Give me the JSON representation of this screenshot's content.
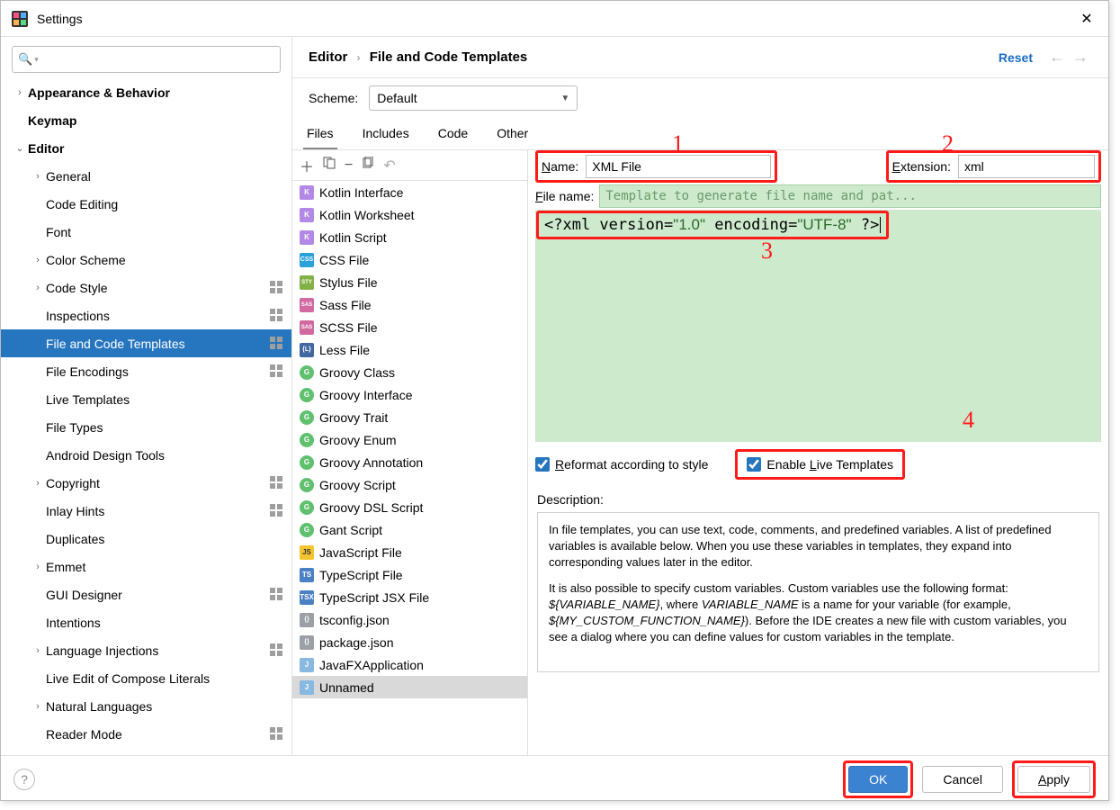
{
  "window": {
    "title": "Settings"
  },
  "crumbs": {
    "section": "Editor",
    "page": "File and Code Templates",
    "reset": "Reset"
  },
  "scheme": {
    "label": "Scheme:",
    "value": "Default"
  },
  "tabs": [
    "Files",
    "Includes",
    "Code",
    "Other"
  ],
  "activeTab": 0,
  "tree": [
    {
      "label": "Appearance & Behavior",
      "bold": true,
      "exp": ">",
      "indent": 0
    },
    {
      "label": "Keymap",
      "bold": true,
      "exp": "",
      "indent": 0
    },
    {
      "label": "Editor",
      "bold": true,
      "exp": "v",
      "indent": 0
    },
    {
      "label": "General",
      "exp": ">",
      "indent": 1
    },
    {
      "label": "Code Editing",
      "exp": "",
      "indent": 1
    },
    {
      "label": "Font",
      "exp": "",
      "indent": 1
    },
    {
      "label": "Color Scheme",
      "exp": ">",
      "indent": 1
    },
    {
      "label": "Code Style",
      "exp": ">",
      "indent": 1,
      "gear": true
    },
    {
      "label": "Inspections",
      "exp": "",
      "indent": 1,
      "gear": true
    },
    {
      "label": "File and Code Templates",
      "exp": "",
      "indent": 1,
      "gear": true,
      "selected": true
    },
    {
      "label": "File Encodings",
      "exp": "",
      "indent": 1,
      "gear": true
    },
    {
      "label": "Live Templates",
      "exp": "",
      "indent": 1
    },
    {
      "label": "File Types",
      "exp": "",
      "indent": 1
    },
    {
      "label": "Android Design Tools",
      "exp": "",
      "indent": 1
    },
    {
      "label": "Copyright",
      "exp": ">",
      "indent": 1,
      "gear": true
    },
    {
      "label": "Inlay Hints",
      "exp": "",
      "indent": 1,
      "gear": true
    },
    {
      "label": "Duplicates",
      "exp": "",
      "indent": 1
    },
    {
      "label": "Emmet",
      "exp": ">",
      "indent": 1
    },
    {
      "label": "GUI Designer",
      "exp": "",
      "indent": 1,
      "gear": true
    },
    {
      "label": "Intentions",
      "exp": "",
      "indent": 1
    },
    {
      "label": "Language Injections",
      "exp": ">",
      "indent": 1,
      "gear": true
    },
    {
      "label": "Live Edit of Compose Literals",
      "exp": "",
      "indent": 1
    },
    {
      "label": "Natural Languages",
      "exp": ">",
      "indent": 1
    },
    {
      "label": "Reader Mode",
      "exp": "",
      "indent": 1,
      "gear": true
    }
  ],
  "files": [
    {
      "label": "Kotlin Interface",
      "cls": "fi-kt"
    },
    {
      "label": "Kotlin Worksheet",
      "cls": "fi-kt"
    },
    {
      "label": "Kotlin Script",
      "cls": "fi-kt"
    },
    {
      "label": "CSS File",
      "cls": "fi-css",
      "txt": "CSS"
    },
    {
      "label": "Stylus File",
      "cls": "fi-styl",
      "txt": "STY"
    },
    {
      "label": "Sass File",
      "cls": "fi-sass",
      "txt": "SAS"
    },
    {
      "label": "SCSS File",
      "cls": "fi-sass",
      "txt": "SAS"
    },
    {
      "label": "Less File",
      "cls": "fi-less",
      "txt": "{L}"
    },
    {
      "label": "Groovy Class",
      "cls": "fi-g",
      "txt": "G"
    },
    {
      "label": "Groovy Interface",
      "cls": "fi-g",
      "txt": "G"
    },
    {
      "label": "Groovy Trait",
      "cls": "fi-g",
      "txt": "G"
    },
    {
      "label": "Groovy Enum",
      "cls": "fi-g",
      "txt": "G"
    },
    {
      "label": "Groovy Annotation",
      "cls": "fi-g",
      "txt": "G"
    },
    {
      "label": "Groovy Script",
      "cls": "fi-g",
      "txt": "G"
    },
    {
      "label": "Groovy DSL Script",
      "cls": "fi-g",
      "txt": "G"
    },
    {
      "label": "Gant Script",
      "cls": "fi-g",
      "txt": "G"
    },
    {
      "label": "JavaScript File",
      "cls": "fi-js",
      "txt": "JS"
    },
    {
      "label": "TypeScript File",
      "cls": "fi-ts",
      "txt": "TS"
    },
    {
      "label": "TypeScript JSX File",
      "cls": "fi-ts",
      "txt": "TSX"
    },
    {
      "label": "tsconfig.json",
      "cls": "fi-json",
      "txt": "{}"
    },
    {
      "label": "package.json",
      "cls": "fi-json",
      "txt": "{}"
    },
    {
      "label": "JavaFXApplication",
      "cls": "fi-generic",
      "txt": "J"
    },
    {
      "label": "Unnamed",
      "cls": "fi-generic",
      "txt": "J",
      "selected": true
    }
  ],
  "form": {
    "nameLabel": "Name:",
    "nameValue": "XML File",
    "extLabel": "Extension:",
    "extValue": "xml",
    "fileNameLabel": "File name:",
    "fileNamePlaceholder": "Template to generate file name and pat...",
    "code": "<?xml version=\"1.0\" encoding=\"UTF-8\" ?>",
    "reformat": "Reformat according to style",
    "liveTemplates": "Enable Live Templates",
    "reformatChecked": true,
    "liveChecked": true
  },
  "desc": {
    "label": "Description:",
    "p1": "In file templates, you can use text, code, comments, and predefined variables. A list of predefined variables is available below. When you use these variables in templates, they expand into corresponding values later in the editor.",
    "p2a": "It is also possible to specify custom variables. Custom variables use the following format: ",
    "var1": "${VARIABLE_NAME}",
    "p2b": ", where ",
    "var2": "VARIABLE_NAME",
    "p2c": " is a name for your variable (for example, ",
    "var3": "${MY_CUSTOM_FUNCTION_NAME}",
    "p2d": "). Before the IDE creates a new file with custom variables, you see a dialog where you can define values for custom variables in the template."
  },
  "buttons": {
    "ok": "OK",
    "cancel": "Cancel",
    "apply": "Apply"
  },
  "annotations": {
    "n1": "1",
    "n2": "2",
    "n3": "3",
    "n4": "4"
  }
}
